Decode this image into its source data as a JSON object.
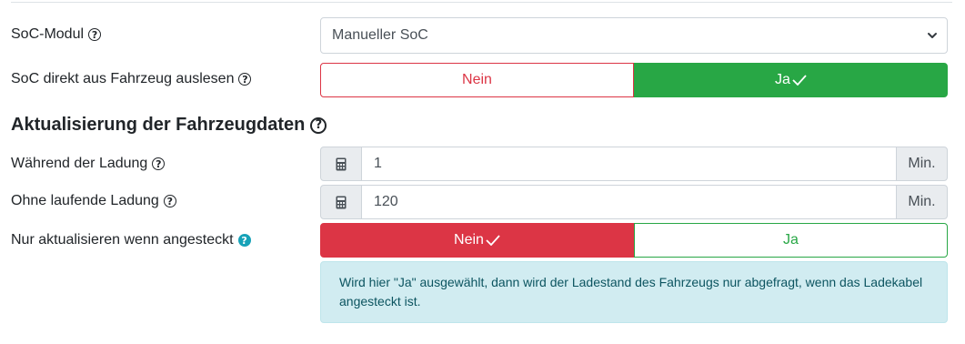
{
  "soc_module": {
    "label": "SoC-Modul",
    "selected": "Manueller SoC"
  },
  "soc_from_vehicle": {
    "label": "SoC direkt aus Fahrzeug auslesen",
    "no_label": "Nein",
    "yes_label": "Ja",
    "selected": "Ja"
  },
  "update_section": {
    "heading": "Aktualisierung der Fahrzeugdaten"
  },
  "while_charging": {
    "label": "Während der Ladung",
    "value": "1",
    "unit": "Min."
  },
  "not_charging": {
    "label": "Ohne laufende Ladung",
    "value": "120",
    "unit": "Min."
  },
  "only_when_plugged": {
    "label": "Nur aktualisieren wenn angesteckt",
    "no_label": "Nein",
    "yes_label": "Ja",
    "selected": "Nein",
    "info": "Wird hier \"Ja\" ausgewählt, dann wird der Ladestand des Fahrzeugs nur abgefragt, wenn das Ladekabel angesteckt ist."
  },
  "colors": {
    "success": "#28a745",
    "danger": "#dc3545",
    "info": "#17a2b8",
    "info_bg": "#d1ecf1"
  },
  "icons": [
    "question-circle-icon",
    "calculator-icon",
    "check-icon",
    "chevron-down-icon"
  ]
}
